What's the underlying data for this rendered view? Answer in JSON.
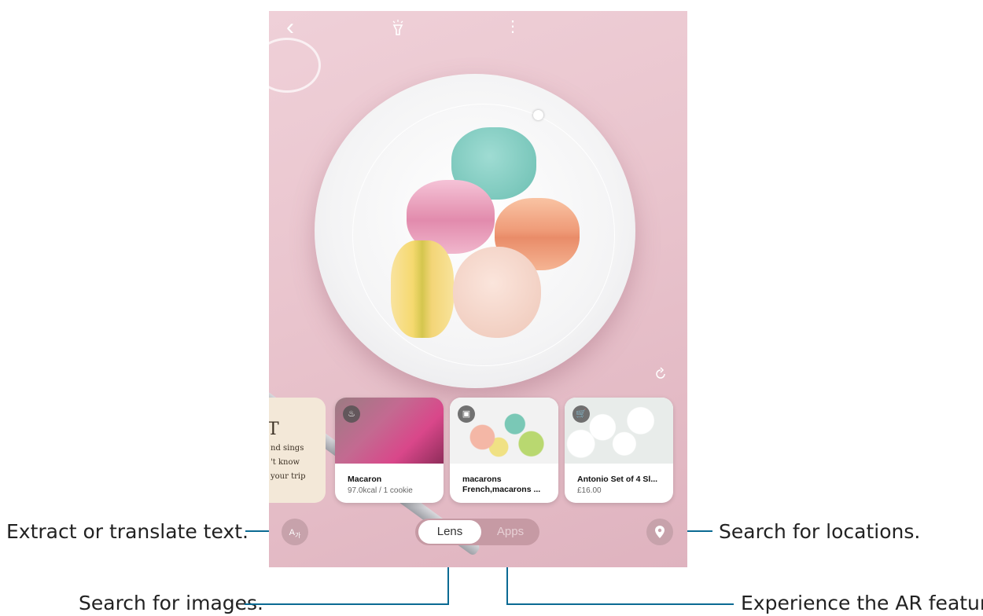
{
  "callouts": {
    "extract_text": "Extract or translate text.",
    "search_images": "Search for images.",
    "search_locations": "Search for locations.",
    "ar_feature": "Experience the AR feature."
  },
  "topbar": {
    "back_icon": "‹",
    "flashlight_icon": "flashlight-icon",
    "more_icon": "⋮"
  },
  "cards": [
    {
      "badge_icon": "food-icon",
      "title": "Macaron",
      "subtitle": "97.0kcal / 1 cookie"
    },
    {
      "badge_icon": "image-icon",
      "title": "macarons",
      "subtitle": "French,macarons ..."
    },
    {
      "badge_icon": "shopping-cart-icon",
      "title": "Antonio Set of 4 Sl...",
      "subtitle": "£16.00"
    }
  ],
  "partial_card": {
    "heading": "T",
    "lines": [
      "nd sings",
      "'t know",
      "your trip"
    ]
  },
  "modes": {
    "lens": "Lens",
    "apps": "Apps"
  },
  "colors": {
    "callout_line": "#0a6a93",
    "phone_bg": "#e9c4cd"
  }
}
